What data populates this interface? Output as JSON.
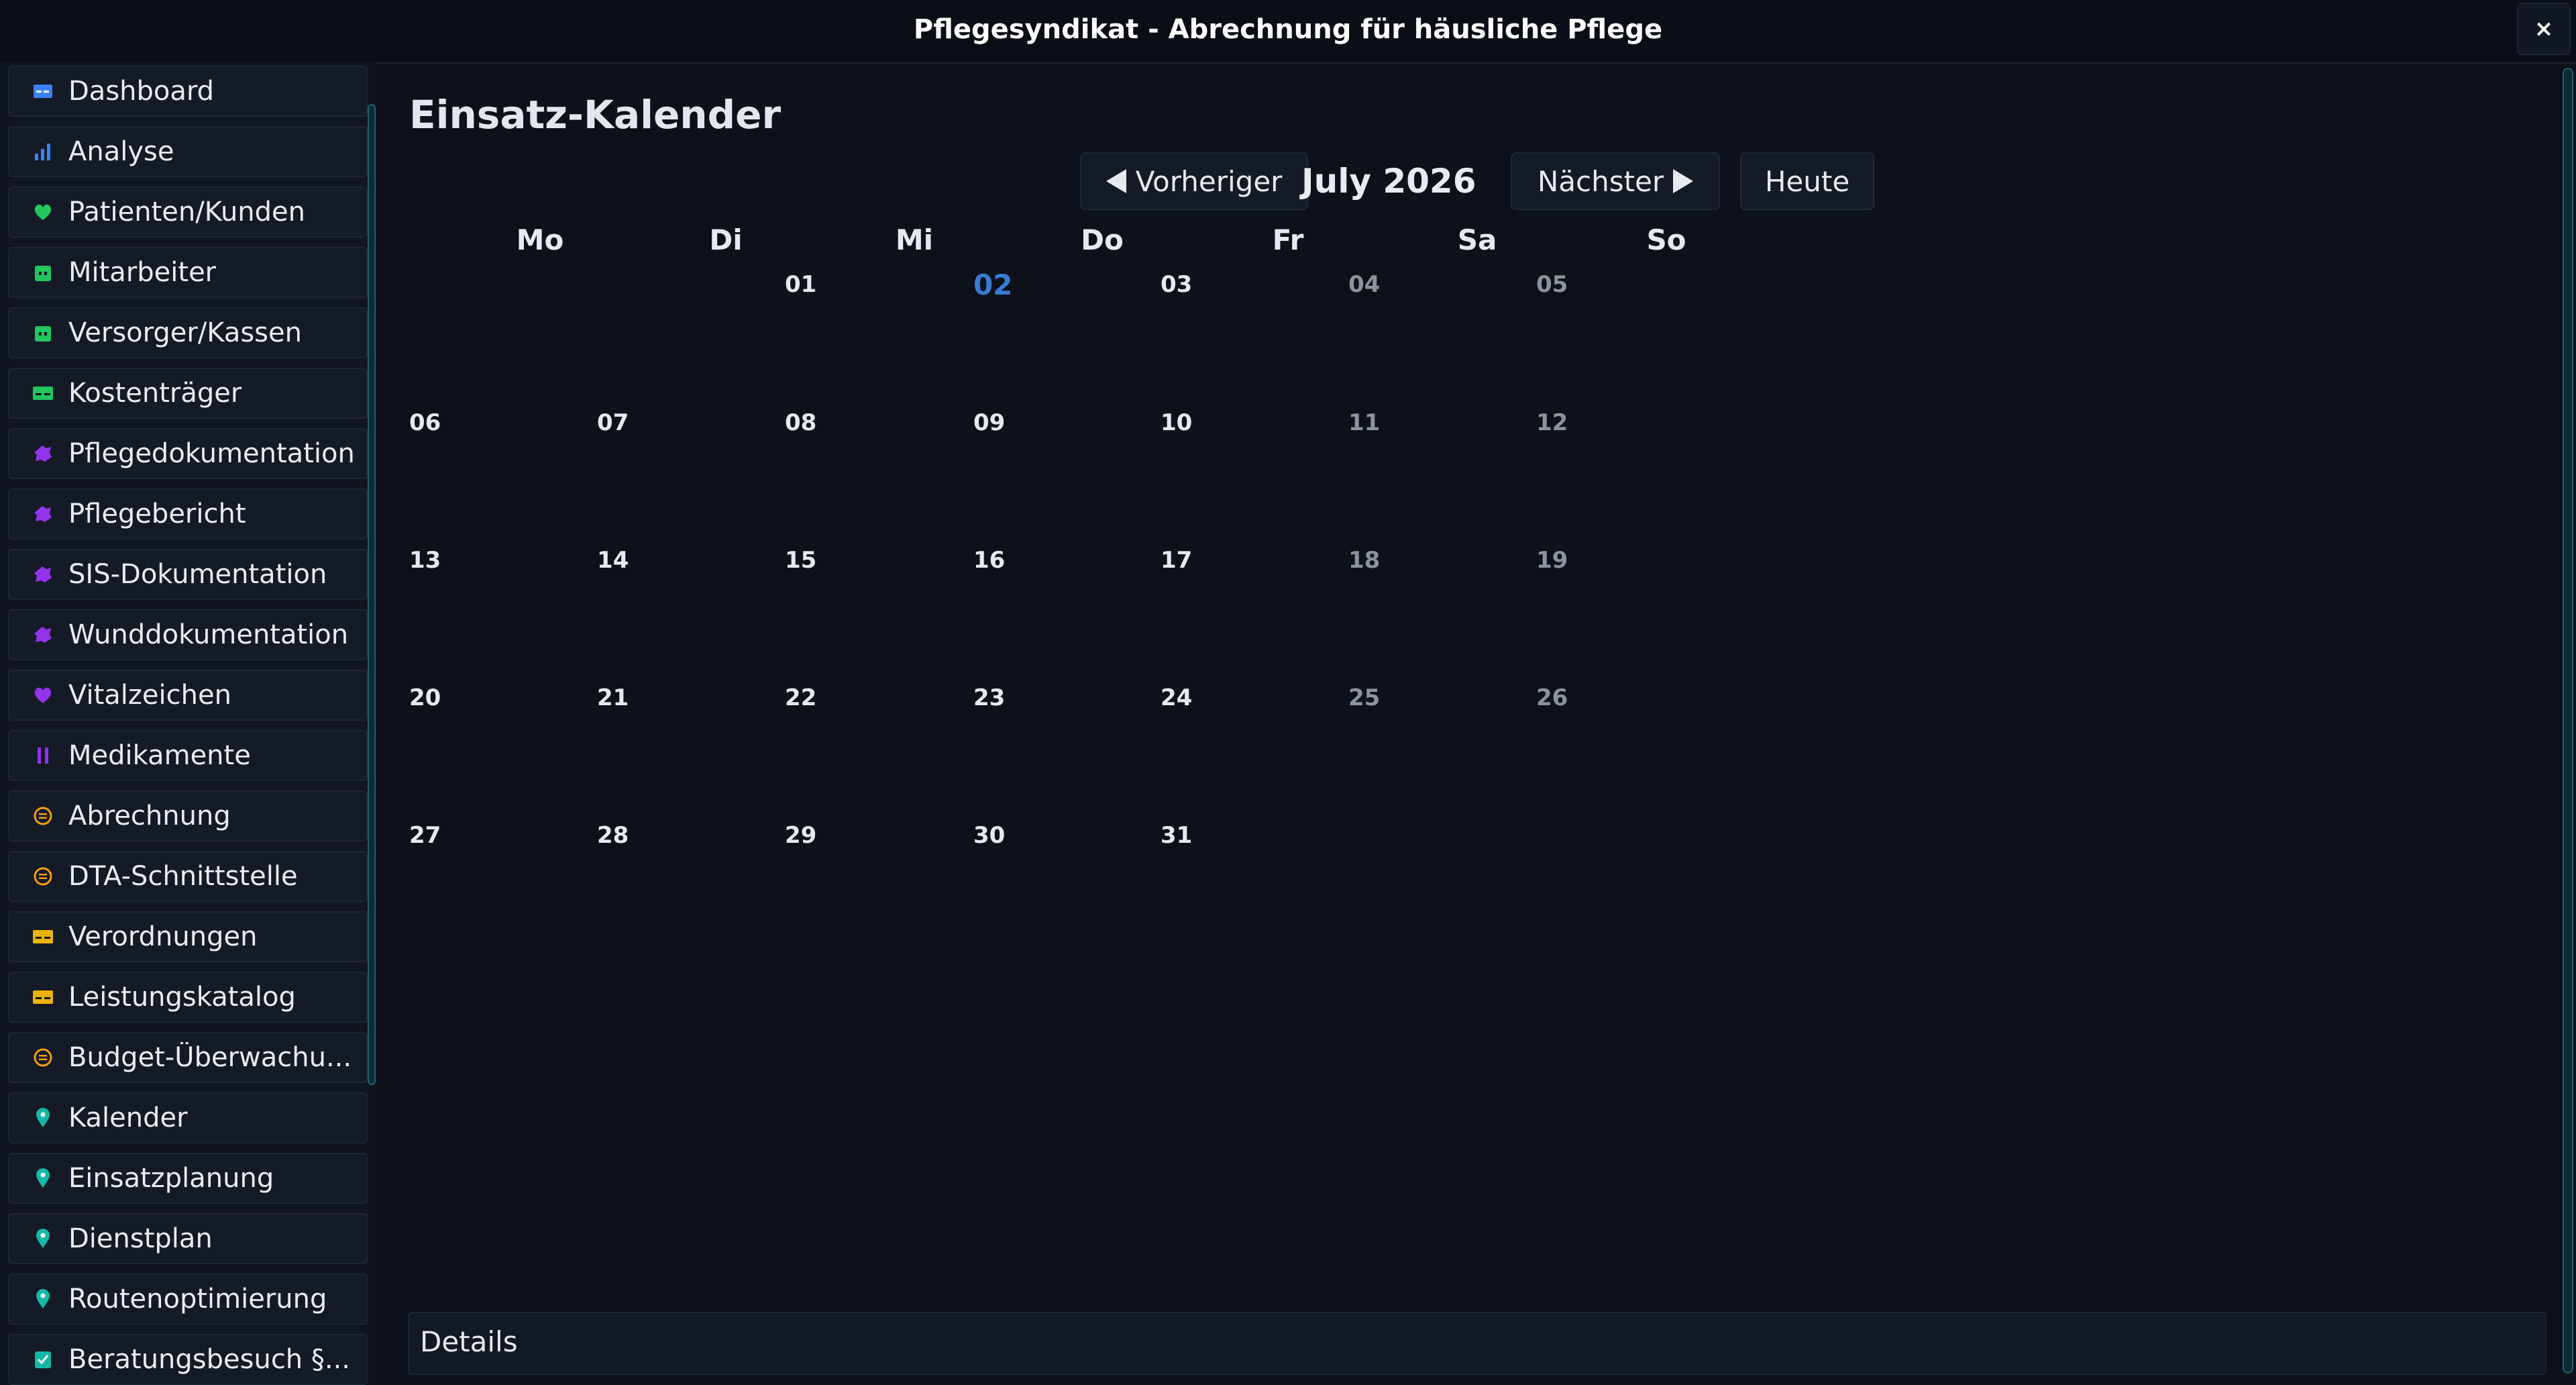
{
  "window": {
    "title": "Pflegesyndikat - Abrechnung für häusliche Pflege",
    "close_label": "×"
  },
  "sidebar": {
    "items": [
      {
        "label": "Dashboard",
        "icon": "dashboard-icon",
        "color": "#3b82f6"
      },
      {
        "label": "Analyse",
        "icon": "bar-chart-icon",
        "color": "#3b82f6"
      },
      {
        "label": "Patienten/Kunden",
        "icon": "heart-icon",
        "color": "#22c55e"
      },
      {
        "label": "Mitarbeiter",
        "icon": "briefcase-icon",
        "color": "#22c55e"
      },
      {
        "label": "Versorger/Kassen",
        "icon": "briefcase-icon",
        "color": "#22c55e"
      },
      {
        "label": "Kostenträger",
        "icon": "card-icon",
        "color": "#22c55e"
      },
      {
        "label": "Pflegedokumentation",
        "icon": "puzzle-icon",
        "color": "#9333ea"
      },
      {
        "label": "Pflegebericht",
        "icon": "puzzle-icon",
        "color": "#9333ea"
      },
      {
        "label": "SIS-Dokumentation",
        "icon": "puzzle-icon",
        "color": "#9333ea"
      },
      {
        "label": "Wunddokumentation",
        "icon": "puzzle-icon",
        "color": "#9333ea"
      },
      {
        "label": "Vitalzeichen",
        "icon": "heart-icon",
        "color": "#9333ea"
      },
      {
        "label": "Medikamente",
        "icon": "pause-icon",
        "color": "#9333ea"
      },
      {
        "label": "Abrechnung",
        "icon": "coin-icon",
        "color": "#f59e0b"
      },
      {
        "label": "DTA-Schnittstelle",
        "icon": "coin-icon",
        "color": "#f59e0b"
      },
      {
        "label": "Verordnungen",
        "icon": "card-icon",
        "color": "#eab308"
      },
      {
        "label": "Leistungskatalog",
        "icon": "card-icon",
        "color": "#eab308"
      },
      {
        "label": "Budget-Überwachu...",
        "icon": "coin-icon",
        "color": "#f59e0b"
      },
      {
        "label": "Kalender",
        "icon": "location-pin-icon",
        "color": "#14b8a6"
      },
      {
        "label": "Einsatzplanung",
        "icon": "location-pin-icon",
        "color": "#14b8a6"
      },
      {
        "label": "Dienstplan",
        "icon": "location-pin-icon",
        "color": "#14b8a6"
      },
      {
        "label": "Routenoptimierung",
        "icon": "location-pin-icon",
        "color": "#14b8a6"
      },
      {
        "label": "Beratungsbesuch §...",
        "icon": "checkbox-icon",
        "color": "#14b8a6"
      }
    ]
  },
  "calendar": {
    "title": "Einsatz-Kalender",
    "prev_label": "Vorheriger",
    "next_label": "Nächster",
    "today_label": "Heute",
    "month_label": "July 2026",
    "weekdays": [
      "Mo",
      "Di",
      "Mi",
      "Do",
      "Fr",
      "Sa",
      "So"
    ],
    "days": [
      "01",
      "02",
      "03",
      "04",
      "05",
      "06",
      "07",
      "08",
      "09",
      "10",
      "11",
      "12",
      "13",
      "14",
      "15",
      "16",
      "17",
      "18",
      "19",
      "20",
      "21",
      "22",
      "23",
      "24",
      "25",
      "26",
      "27",
      "28",
      "29",
      "30",
      "31"
    ],
    "today": "02",
    "today_color": "#3a7bd5"
  },
  "details": {
    "label": "Details"
  }
}
